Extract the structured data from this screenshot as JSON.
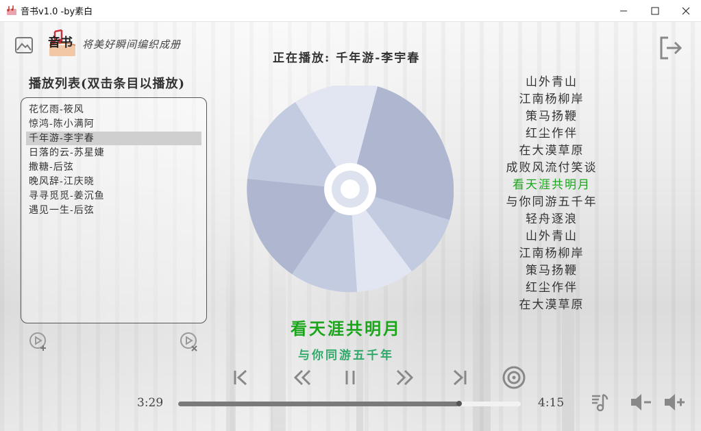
{
  "window": {
    "title": "音书v1.0  -by素白"
  },
  "header": {
    "tagline": "将美好瞬间编织成册",
    "now_playing": "正在播放: 千年游-李宇春",
    "logo_text": "音书"
  },
  "playlist": {
    "title": "播放列表(双击条目以播放)",
    "selected_index": 2,
    "items": [
      {
        "label": "花忆雨-筱风"
      },
      {
        "label": "惊鸿-陈小满阿"
      },
      {
        "label": "千年游-李宇春"
      },
      {
        "label": "日落的云-苏星婕"
      },
      {
        "label": "撒糖-后弦"
      },
      {
        "label": "晚风辞-江庆晓"
      },
      {
        "label": "寻寻觅觅-姜沉鱼"
      },
      {
        "label": "遇见一生-后弦"
      }
    ]
  },
  "lyrics": {
    "current_index": 6,
    "lines": [
      "山外青山",
      "江南杨柳岸",
      "策马扬鞭",
      "红尘作伴",
      "在大漠草原",
      "成败风流付笑谈",
      "看天涯共明月",
      "与你同游五千年",
      "轻舟逐浪",
      "山外青山",
      "江南杨柳岸",
      "策马扬鞭",
      "红尘作伴",
      "在大漠草原"
    ],
    "current_big": "看天涯共明月",
    "next_big": "与你同游五千年"
  },
  "player": {
    "elapsed": "3:29",
    "total": "4:15",
    "progress_fraction": 0.82
  },
  "colors": {
    "accent_green": "#1aa51a",
    "next_line_green": "#2fa86a",
    "icon_gray": "#888888",
    "disc_light": "#e2e6f3",
    "disc_mid": "#c3cbe0",
    "disc_dark": "#aeb6d0"
  },
  "icons": {
    "picture": "image-icon",
    "logout": "exit-icon",
    "add_song": "add-song-icon",
    "remove_song": "remove-song-icon",
    "prev": "skip-previous-icon",
    "rewind": "rewind-icon",
    "pause": "pause-icon",
    "forward": "fast-forward-icon",
    "next": "skip-next-icon",
    "disc_mode": "disc-icon",
    "lyrics_mode": "music-note-icon",
    "volume_down": "volume-down-icon",
    "volume_up": "volume-up-icon"
  }
}
